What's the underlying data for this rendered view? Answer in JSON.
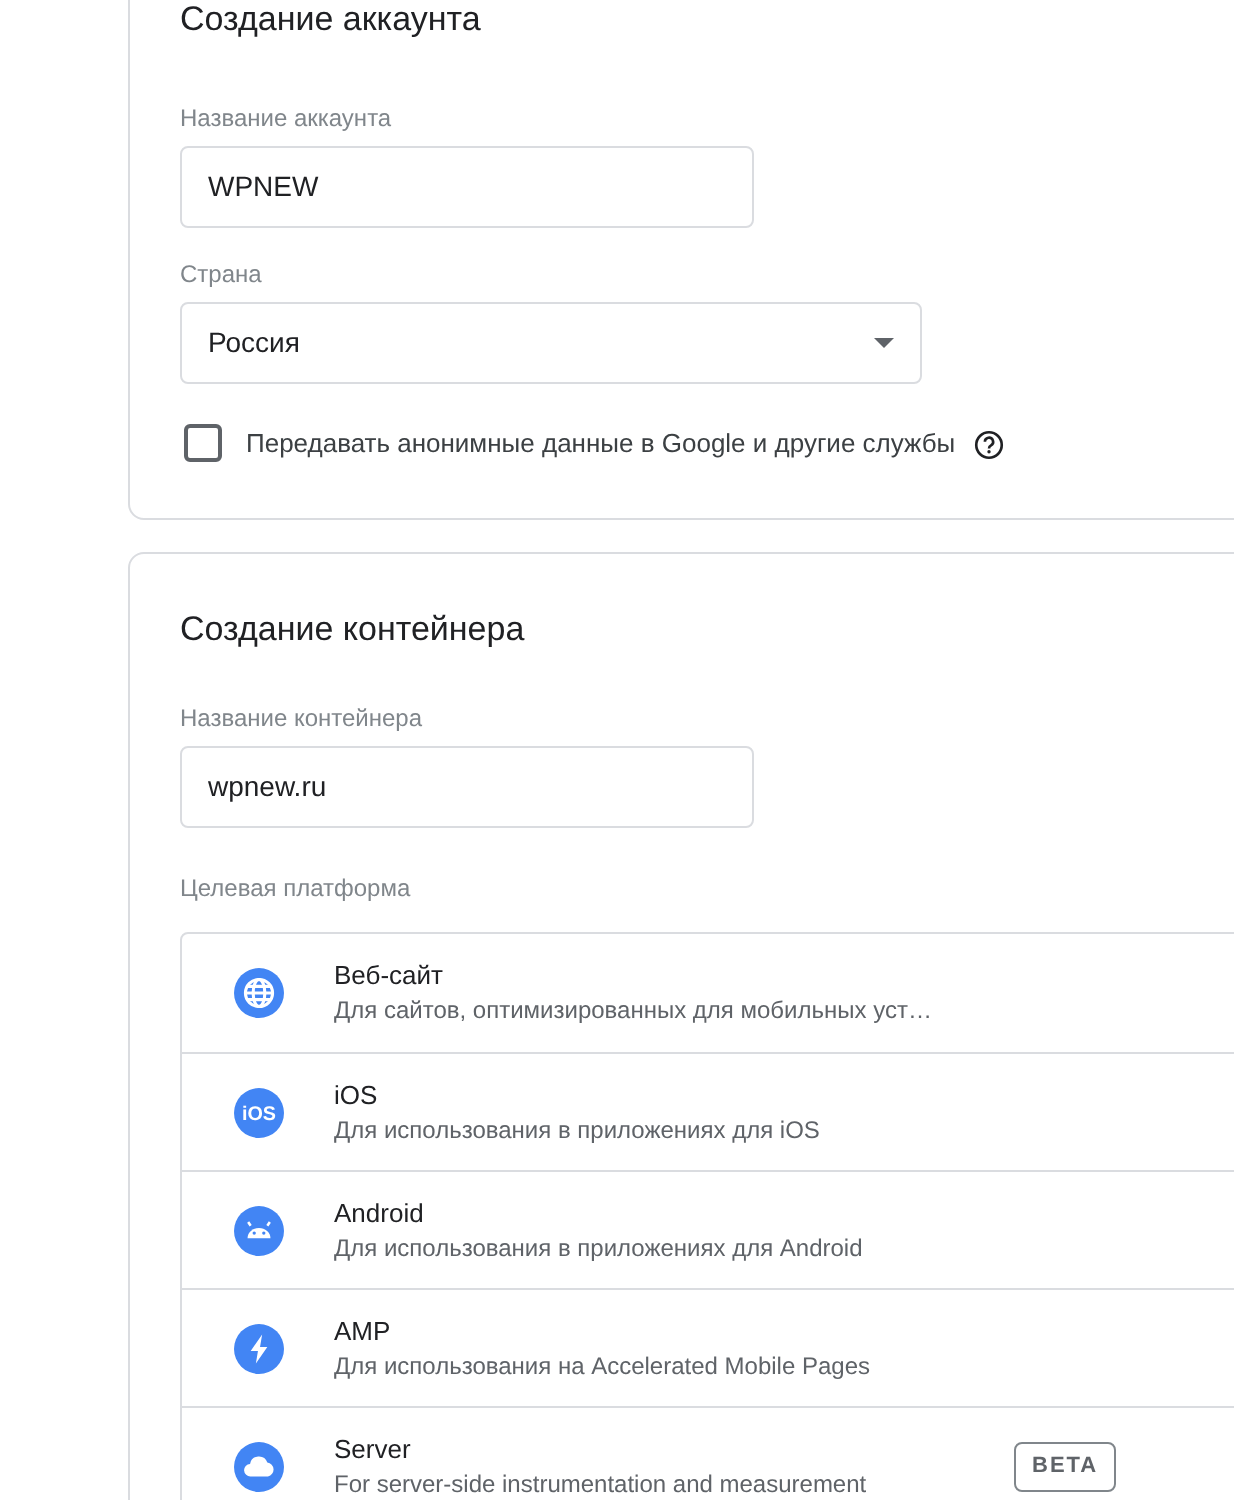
{
  "account": {
    "title": "Создание аккаунта",
    "name_field": {
      "label": "Название аккаунта",
      "value": "WPNEW"
    },
    "country_field": {
      "label": "Страна",
      "value": "Россия"
    },
    "share_data": {
      "label": "Передавать анонимные данные в Google и другие службы",
      "checked": false
    }
  },
  "container": {
    "title": "Создание контейнера",
    "name_field": {
      "label": "Название контейнера",
      "value": "wpnew.ru"
    },
    "platform_label": "Целевая платформа",
    "platforms": [
      {
        "kind": "web",
        "title": "Веб-сайт",
        "subtitle": "Для сайтов, оптимизированных для мобильных уст…"
      },
      {
        "kind": "ios",
        "icon_text": "iOS",
        "title": "iOS",
        "subtitle": "Для использования в приложениях для iOS"
      },
      {
        "kind": "android",
        "title": "Android",
        "subtitle": "Для использования в приложениях для Android"
      },
      {
        "kind": "amp",
        "title": "AMP",
        "subtitle": "Для использования на Accelerated Mobile Pages"
      },
      {
        "kind": "server",
        "title": "Server",
        "subtitle": "For server-side instrumentation and measurement",
        "badge": "BETA"
      }
    ]
  }
}
